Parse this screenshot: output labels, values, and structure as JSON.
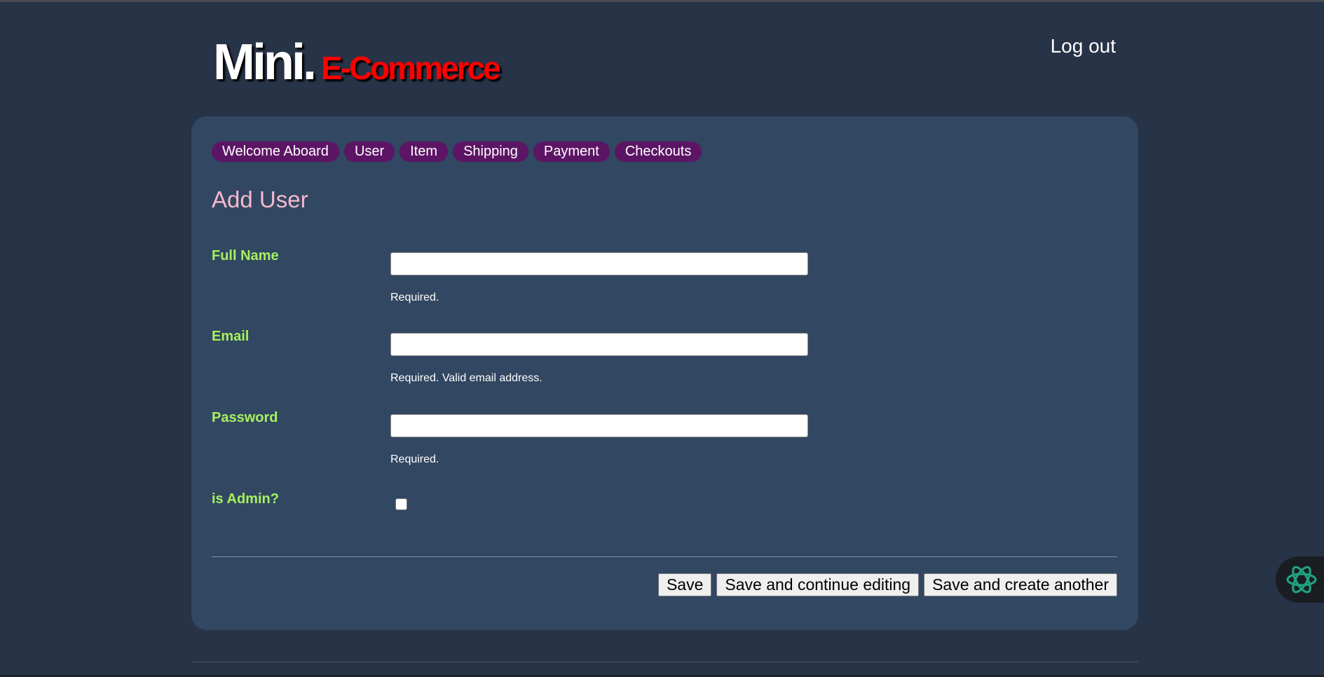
{
  "header": {
    "logo_main": "Mini.",
    "logo_sub": "E-Commerce",
    "logout_label": "Log out"
  },
  "nav": {
    "items": [
      {
        "label": "Welcome Aboard"
      },
      {
        "label": "User"
      },
      {
        "label": "Item"
      },
      {
        "label": "Shipping"
      },
      {
        "label": "Payment"
      },
      {
        "label": "Checkouts"
      }
    ]
  },
  "form": {
    "title": "Add User",
    "full_name": {
      "label": "Full Name",
      "value": "",
      "help": "Required."
    },
    "email": {
      "label": "Email",
      "value": "",
      "help": "Required. Valid email address."
    },
    "password": {
      "label": "Password",
      "value": "",
      "help": "Required."
    },
    "is_admin": {
      "label": "is Admin?",
      "checked": false
    }
  },
  "actions": {
    "save": "Save",
    "save_continue": "Save and continue editing",
    "save_another": "Save and create another"
  },
  "assistant": {
    "icon": "openai-swirl-icon"
  },
  "colors": {
    "background": "#273347",
    "panel": "#324762",
    "nav_pill": "#5c1564",
    "label": "#a6f05f",
    "title": "#f4b9cd",
    "logo_sub": "#ff0000"
  }
}
